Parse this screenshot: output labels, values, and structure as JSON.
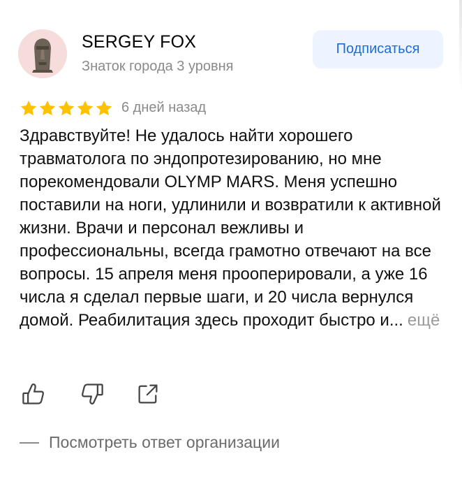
{
  "author": {
    "name": "SERGEY FOX",
    "level": "Знаток города 3 уровня",
    "avatar_icon": "moai-statue-avatar"
  },
  "subscribe_label": "Подписаться",
  "rating": {
    "stars": 5,
    "max": 5,
    "color": "#fcc200"
  },
  "date": "6 дней назад",
  "review": {
    "text": "Здравствуйте! Не удалось найти хорошего травматолога по эндопротезированию, но мне порекомендовали OLYMP MARS. Меня успешно поставили на ноги, удлинили и возвратили к активной жизни. Врачи и персонал вежливы и профессиональны, всегда грамотно отвечают на все вопросы. 15 апреля меня прооперировали, а уже 16 числа я сделал первые шаги, и 20 числа вернулся домой. Реабилитация здесь проходит быстро и...",
    "more_label": "ещё"
  },
  "actions": {
    "like_icon": "thumbs-up-icon",
    "dislike_icon": "thumbs-down-icon",
    "share_icon": "share-icon"
  },
  "reply_label": "Посмотреть ответ организации",
  "colors": {
    "accent": "#1c6cd6",
    "subscribe_bg": "#eef4ff",
    "muted": "#8a8a8a"
  }
}
